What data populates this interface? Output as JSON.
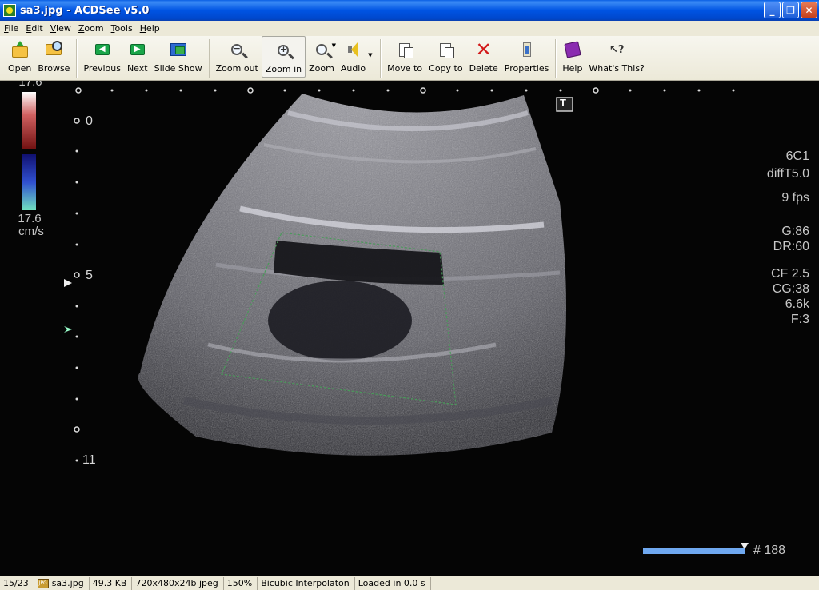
{
  "window": {
    "title": "sa3.jpg - ACDSee v5.0",
    "minimize": "_",
    "maximize": "❐",
    "close": "✕"
  },
  "menu": [
    {
      "label": "File",
      "mnemonic": "F"
    },
    {
      "label": "Edit",
      "mnemonic": "E"
    },
    {
      "label": "View",
      "mnemonic": "V"
    },
    {
      "label": "Zoom",
      "mnemonic": "Z"
    },
    {
      "label": "Tools",
      "mnemonic": "T"
    },
    {
      "label": "Help",
      "mnemonic": "H"
    }
  ],
  "toolbar": {
    "open": "Open",
    "browse": "Browse",
    "previous": "Previous",
    "next": "Next",
    "slideshow": "Slide Show",
    "zoom_out": "Zoom out",
    "zoom_in": "Zoom in",
    "zoom": "Zoom",
    "audio": "Audio",
    "move_to": "Move to",
    "copy_to": "Copy to",
    "delete": "Delete",
    "properties": "Properties",
    "help": "Help",
    "whats_this": "What's This?"
  },
  "image": {
    "scale_top": "17.6",
    "scale_bottom": "17.6",
    "scale_unit": "cm/s",
    "depth_0": "0",
    "depth_5": "5",
    "depth_11": "11",
    "probe": "6C1",
    "mode": "diffT5.0",
    "fps": "9 fps",
    "gain": "G:86",
    "dr": "DR:60",
    "cf": "CF 2.5",
    "cg": "CG:38",
    "prf": "6.6k",
    "filter": "F:3",
    "frame": "# 188",
    "t_marker": "T",
    "colors": {
      "green_box": "#4a9a5a",
      "overlay_text": "#c8c8c8"
    }
  },
  "status": {
    "index": "15/23",
    "filename": "sa3.jpg",
    "filesize": "49.3 KB",
    "dimensions": "720x480x24b jpeg",
    "zoom": "150%",
    "interpolation": "Bicubic Interpolaton",
    "load_time": "Loaded in 0.0 s"
  }
}
